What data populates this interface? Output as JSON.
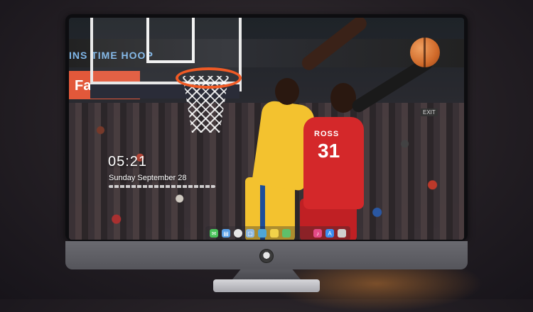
{
  "wallpaper": {
    "banner_left": "Farm",
    "banner_top": "INS TIME HOOP",
    "jersey_name": "ROSS",
    "jersey_number": "31",
    "exit_sign": "EXIT"
  },
  "lock_screen": {
    "time": "05:21",
    "date": "Sunday September  28"
  },
  "dock": {
    "icons": [
      {
        "name": "messages-icon",
        "color": "#49c15a"
      },
      {
        "name": "files-icon",
        "color": "#5aa0e8"
      },
      {
        "name": "chrome-icon",
        "color": "#e6e6e6"
      },
      {
        "name": "preview-icon",
        "color": "#8fb9e0"
      },
      {
        "name": "folder-icon",
        "color": "#4fa6d8"
      },
      {
        "name": "notes-icon",
        "color": "#f2d24a"
      },
      {
        "name": "maps-icon",
        "color": "#5fbf6a"
      },
      {
        "name": "music-icon",
        "color": "#e44a86"
      },
      {
        "name": "appstore-icon",
        "color": "#3b8ef0"
      },
      {
        "name": "photos-icon",
        "color": "#cfcfcf"
      }
    ]
  }
}
